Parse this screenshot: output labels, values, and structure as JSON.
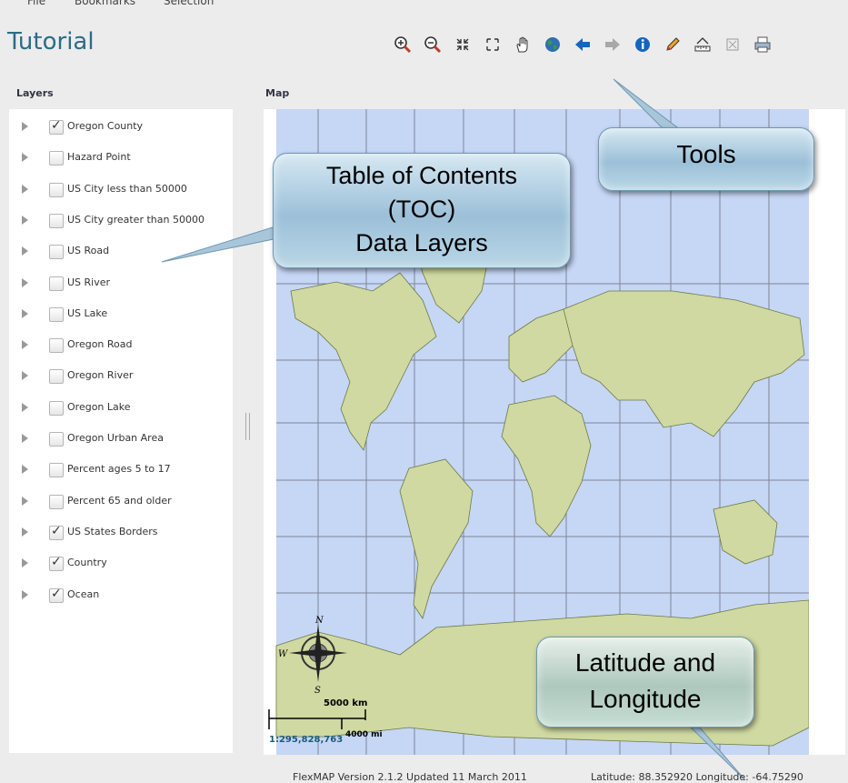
{
  "menu": {
    "file": "File",
    "bookmarks": "Bookmarks",
    "selection": "Selection"
  },
  "app_title": "Tutorial",
  "toolbar": {
    "tools": [
      {
        "name": "zoom-in-icon"
      },
      {
        "name": "zoom-out-icon"
      },
      {
        "name": "zoom-to-fit-icon"
      },
      {
        "name": "full-extent-icon"
      },
      {
        "name": "pan-hand-icon"
      },
      {
        "name": "globe-icon"
      },
      {
        "name": "previous-extent-icon"
      },
      {
        "name": "next-extent-icon"
      },
      {
        "name": "info-icon"
      },
      {
        "name": "draw-pencil-icon"
      },
      {
        "name": "measure-icon"
      },
      {
        "name": "clear-icon"
      },
      {
        "name": "print-icon"
      }
    ],
    "colors": {
      "zoom": "#c0392b",
      "globe": "#2e7d32",
      "arrow_back": "#1565c0",
      "arrow_fwd": "#9e9e9e",
      "info": "#1565c0",
      "pencil": "#e67e22"
    }
  },
  "layers_panel": {
    "title": "Layers",
    "items": [
      {
        "label": "Oregon County",
        "checked": true
      },
      {
        "label": "Hazard Point",
        "checked": false
      },
      {
        "label": "US City less than 50000",
        "checked": false
      },
      {
        "label": "US City greater than 50000",
        "checked": false
      },
      {
        "label": "US Road",
        "checked": false
      },
      {
        "label": "US River",
        "checked": false
      },
      {
        "label": "US Lake",
        "checked": false
      },
      {
        "label": "Oregon Road",
        "checked": false
      },
      {
        "label": "Oregon River",
        "checked": false
      },
      {
        "label": "Oregon Lake",
        "checked": false
      },
      {
        "label": "Oregon Urban Area",
        "checked": false
      },
      {
        "label": "Percent ages 5 to 17",
        "checked": false
      },
      {
        "label": "Percent 65 and older",
        "checked": false
      },
      {
        "label": "US States Borders",
        "checked": true
      },
      {
        "label": "Country",
        "checked": true
      },
      {
        "label": "Ocean",
        "checked": true
      }
    ]
  },
  "map_panel": {
    "title": "Map",
    "ocean_color": "#c6d6f5",
    "land_color": "#cfd9a1",
    "scale_km": "5000 km",
    "scale_mi": "4000 mi",
    "scale_ratio": "1:295,828,763",
    "compass": {
      "n": "N",
      "w": "W",
      "s": "S"
    }
  },
  "callouts": {
    "toc": "Table of Contents (TOC) Data Layers",
    "toc_lines": [
      "Table of Contents",
      "(TOC)",
      "Data Layers"
    ],
    "tools": "Tools",
    "latlon_lines": [
      "Latitude and",
      "Longitude"
    ]
  },
  "status": {
    "version": "FlexMAP Version 2.1.2 Updated 11 March 2011",
    "coords": "Latitude: 88.352920 Longitude: -64.75290"
  }
}
